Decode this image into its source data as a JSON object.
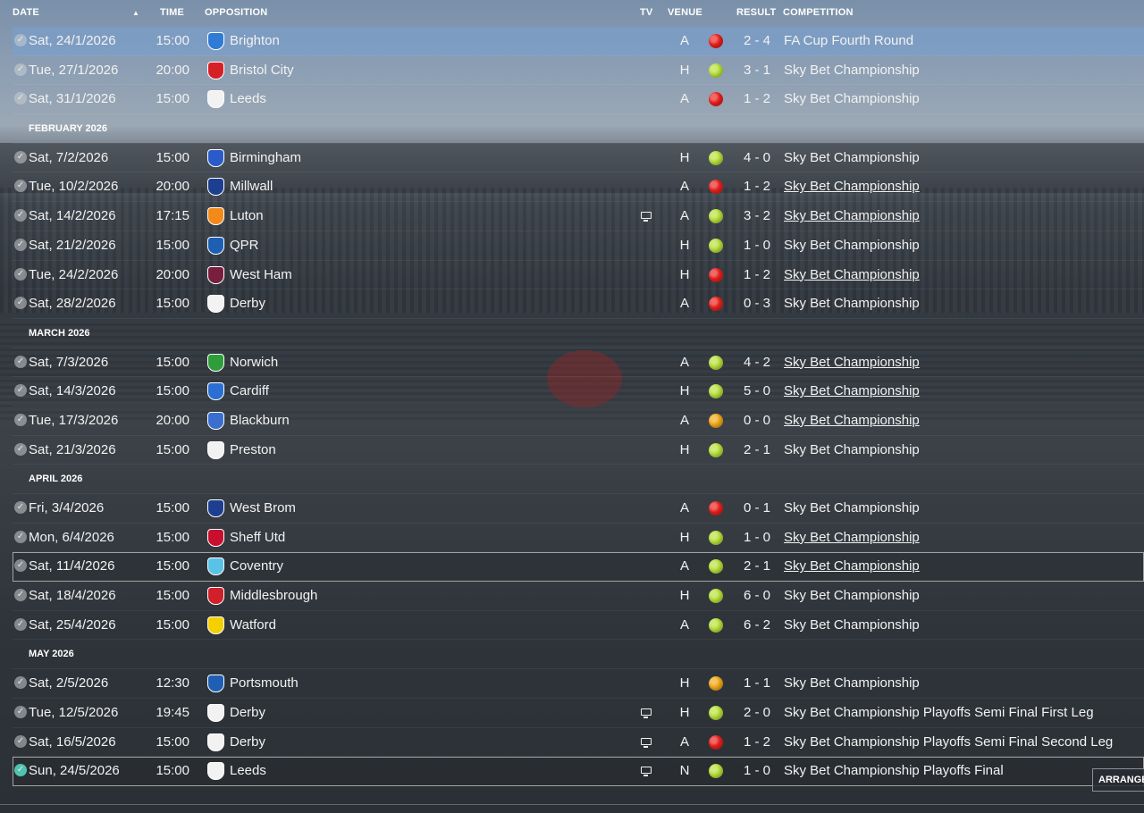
{
  "header": {
    "date": "DATE",
    "sort_icon": "sort-ascending-icon",
    "time": "TIME",
    "opposition": "OPPOSITION",
    "tv": "TV",
    "venue": "VENUE",
    "result": "RESULT",
    "competition": "COMPETITION"
  },
  "colors": {
    "win": "#b8e03a",
    "loss": "#e8201c",
    "draw": "#f0a818",
    "selected_row": "#6f96c8"
  },
  "rows": [
    {
      "kind": "match",
      "date": "Sat, 24/1/2026",
      "time": "15:00",
      "opp": "Brighton",
      "crest": "#2f7bd6",
      "tv": false,
      "venue": "A",
      "result": "2 - 4",
      "outcome": "loss",
      "comp": "FA Cup Fourth Round",
      "link": false,
      "state": "selected"
    },
    {
      "kind": "match",
      "date": "Tue, 27/1/2026",
      "time": "20:00",
      "opp": "Bristol City",
      "crest": "#d62027",
      "tv": false,
      "venue": "H",
      "result": "3 - 1",
      "outcome": "win",
      "comp": "Sky Bet Championship",
      "link": false
    },
    {
      "kind": "match",
      "date": "Sat, 31/1/2026",
      "time": "15:00",
      "opp": "Leeds",
      "crest": "#f2f2f2",
      "tv": false,
      "venue": "A",
      "result": "1 - 2",
      "outcome": "loss",
      "comp": "Sky Bet Championship",
      "link": false
    },
    {
      "kind": "month",
      "label": "FEBRUARY 2026"
    },
    {
      "kind": "match",
      "date": "Sat, 7/2/2026",
      "time": "15:00",
      "opp": "Birmingham",
      "crest": "#2a5bc9",
      "tv": false,
      "venue": "H",
      "result": "4 - 0",
      "outcome": "win",
      "comp": "Sky Bet Championship",
      "link": false
    },
    {
      "kind": "match",
      "date": "Tue, 10/2/2026",
      "time": "20:00",
      "opp": "Millwall",
      "crest": "#1d3f8f",
      "tv": false,
      "venue": "A",
      "result": "1 - 2",
      "outcome": "loss",
      "comp": "Sky Bet Championship",
      "link": true
    },
    {
      "kind": "match",
      "date": "Sat, 14/2/2026",
      "time": "17:15",
      "opp": "Luton",
      "crest": "#f28a1a",
      "tv": true,
      "venue": "A",
      "result": "3 - 2",
      "outcome": "win",
      "comp": "Sky Bet Championship",
      "link": true
    },
    {
      "kind": "match",
      "date": "Sat, 21/2/2026",
      "time": "15:00",
      "opp": "QPR",
      "crest": "#1e5fb4",
      "tv": false,
      "venue": "H",
      "result": "1 - 0",
      "outcome": "win",
      "comp": "Sky Bet Championship",
      "link": false
    },
    {
      "kind": "match",
      "date": "Tue, 24/2/2026",
      "time": "20:00",
      "opp": "West Ham",
      "crest": "#7a1e3e",
      "tv": false,
      "venue": "H",
      "result": "1 - 2",
      "outcome": "loss",
      "comp": "Sky Bet Championship",
      "link": true
    },
    {
      "kind": "match",
      "date": "Sat, 28/2/2026",
      "time": "15:00",
      "opp": "Derby",
      "crest": "#f2f2f2",
      "tv": false,
      "venue": "A",
      "result": "0 - 3",
      "outcome": "loss",
      "comp": "Sky Bet Championship",
      "link": false
    },
    {
      "kind": "month",
      "label": "MARCH 2026"
    },
    {
      "kind": "match",
      "date": "Sat, 7/3/2026",
      "time": "15:00",
      "opp": "Norwich",
      "crest": "#2f9e3a",
      "tv": false,
      "venue": "A",
      "result": "4 - 2",
      "outcome": "win",
      "comp": "Sky Bet Championship",
      "link": true
    },
    {
      "kind": "match",
      "date": "Sat, 14/3/2026",
      "time": "15:00",
      "opp": "Cardiff",
      "crest": "#2a6fd1",
      "tv": false,
      "venue": "H",
      "result": "5 - 0",
      "outcome": "win",
      "comp": "Sky Bet Championship",
      "link": true
    },
    {
      "kind": "match",
      "date": "Tue, 17/3/2026",
      "time": "20:00",
      "opp": "Blackburn",
      "crest": "#3a6fd0",
      "tv": false,
      "venue": "A",
      "result": "0 - 0",
      "outcome": "draw",
      "comp": "Sky Bet Championship",
      "link": true
    },
    {
      "kind": "match",
      "date": "Sat, 21/3/2026",
      "time": "15:00",
      "opp": "Preston",
      "crest": "#f2f2f2",
      "tv": false,
      "venue": "H",
      "result": "2 - 1",
      "outcome": "win",
      "comp": "Sky Bet Championship",
      "link": false
    },
    {
      "kind": "month",
      "label": "APRIL 2026"
    },
    {
      "kind": "match",
      "date": "Fri, 3/4/2026",
      "time": "15:00",
      "opp": "West Brom",
      "crest": "#1e3f8f",
      "tv": false,
      "venue": "A",
      "result": "0 - 1",
      "outcome": "loss",
      "comp": "Sky Bet Championship",
      "link": false
    },
    {
      "kind": "match",
      "date": "Mon, 6/4/2026",
      "time": "15:00",
      "opp": "Sheff Utd",
      "crest": "#c8102e",
      "tv": false,
      "venue": "H",
      "result": "1 - 0",
      "outcome": "win",
      "comp": "Sky Bet Championship",
      "link": true
    },
    {
      "kind": "match",
      "date": "Sat, 11/4/2026",
      "time": "15:00",
      "opp": "Coventry",
      "crest": "#5bc2e7",
      "tv": false,
      "venue": "A",
      "result": "2 - 1",
      "outcome": "win",
      "comp": "Sky Bet Championship",
      "link": true,
      "state": "boxed"
    },
    {
      "kind": "match",
      "date": "Sat, 18/4/2026",
      "time": "15:00",
      "opp": "Middlesbrough",
      "crest": "#d0202a",
      "tv": false,
      "venue": "H",
      "result": "6 - 0",
      "outcome": "win",
      "comp": "Sky Bet Championship",
      "link": false
    },
    {
      "kind": "match",
      "date": "Sat, 25/4/2026",
      "time": "15:00",
      "opp": "Watford",
      "crest": "#f5d000",
      "tv": false,
      "venue": "A",
      "result": "6 - 2",
      "outcome": "win",
      "comp": "Sky Bet Championship",
      "link": false
    },
    {
      "kind": "month",
      "label": "MAY 2026"
    },
    {
      "kind": "match",
      "date": "Sat, 2/5/2026",
      "time": "12:30",
      "opp": "Portsmouth",
      "crest": "#1e5fb4",
      "tv": false,
      "venue": "H",
      "result": "1 - 1",
      "outcome": "draw",
      "comp": "Sky Bet Championship",
      "link": false
    },
    {
      "kind": "match",
      "date": "Tue, 12/5/2026",
      "time": "19:45",
      "opp": "Derby",
      "crest": "#f2f2f2",
      "tv": true,
      "venue": "H",
      "result": "2 - 0",
      "outcome": "win",
      "comp": "Sky Bet Championship Playoffs Semi Final First Leg",
      "link": false
    },
    {
      "kind": "match",
      "date": "Sat, 16/5/2026",
      "time": "15:00",
      "opp": "Derby",
      "crest": "#f2f2f2",
      "tv": true,
      "venue": "A",
      "result": "1 - 2",
      "outcome": "loss",
      "comp": "Sky Bet Championship Playoffs Semi Final Second Leg",
      "link": false
    },
    {
      "kind": "match",
      "date": "Sun, 24/5/2026",
      "time": "15:00",
      "opp": "Leeds",
      "crest": "#f2f2f2",
      "tv": true,
      "venue": "N",
      "result": "1 - 0",
      "outcome": "win",
      "comp": "Sky Bet Championship Playoffs Final",
      "link": false,
      "state": "boxed",
      "active": true
    }
  ],
  "footer": {
    "arrange_label": "ARRANGE"
  }
}
